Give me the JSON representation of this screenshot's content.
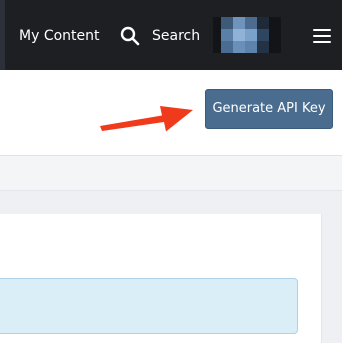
{
  "nav": {
    "my_content": "My Content",
    "search_label": "Search",
    "search_icon": "search-icon",
    "menu_icon": "hamburger-menu-icon"
  },
  "header": {
    "generate_api_key": "Generate API Key"
  },
  "colors": {
    "nav_bg": "#1d1f23",
    "button_bg": "#4a6d8f",
    "arrow": "#f03a1c",
    "info_bg": "#d9eef7"
  }
}
